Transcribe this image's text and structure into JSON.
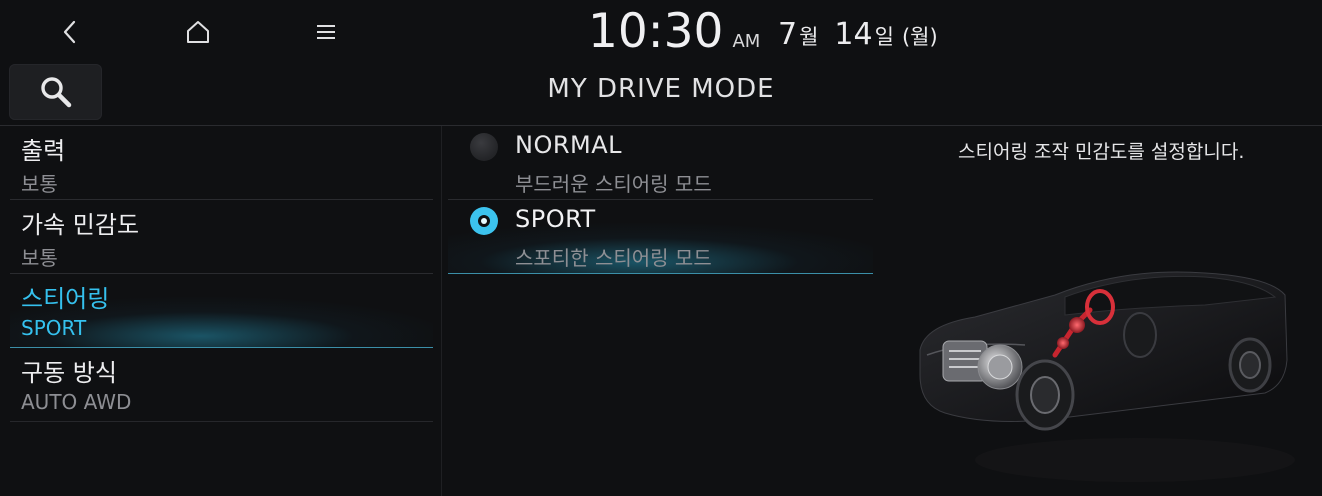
{
  "topbar": {
    "back_icon": "chevron-left-icon",
    "home_icon": "home-icon",
    "menu_icon": "hamburger-menu-icon",
    "time": "10:30",
    "ampm": "AM",
    "month": "7",
    "month_unit": "월",
    "day": "14",
    "day_unit": "일",
    "weekday": "(월)"
  },
  "search": {
    "icon": "search-icon"
  },
  "page": {
    "title": "MY DRIVE MODE"
  },
  "settings": [
    {
      "label": "출력",
      "value": "보통"
    },
    {
      "label": "가속 민감도",
      "value": "보통"
    },
    {
      "label": "스티어링",
      "value": "SPORT"
    },
    {
      "label": "구동 방식",
      "value": "AUTO AWD"
    }
  ],
  "options": [
    {
      "label": "NORMAL",
      "description": "부드러운 스티어링 모드"
    },
    {
      "label": "SPORT",
      "description": "스포티한 스티어링 모드"
    }
  ],
  "detail": {
    "description": "스티어링 조작 민감도를 설정합니다.",
    "image": "car-steering-illustration"
  },
  "colors": {
    "accent": "#35c1ee",
    "background": "#0f1012",
    "highlight_steering": "#d8303a"
  }
}
